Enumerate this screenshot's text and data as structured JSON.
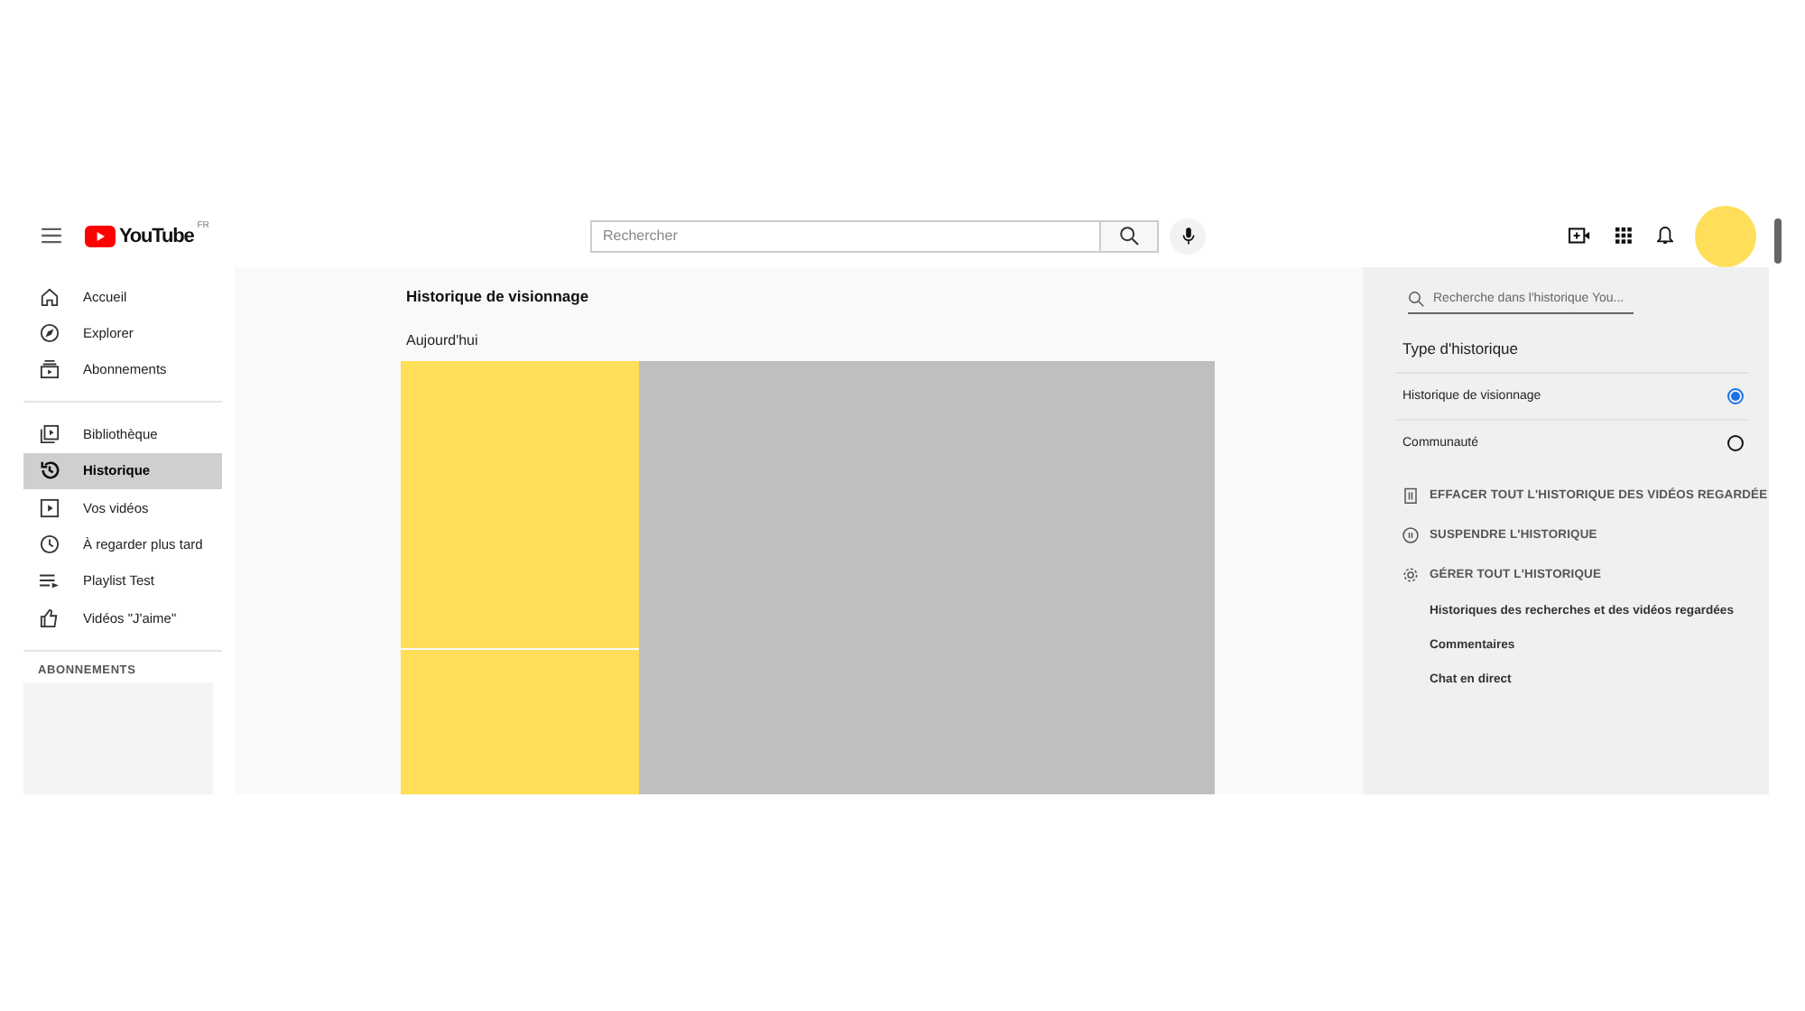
{
  "header": {
    "logo_text": "YouTube",
    "region": "FR",
    "search_placeholder": "Rechercher"
  },
  "sidebar": {
    "sections": [
      [
        {
          "label": "Accueil",
          "kind": "home",
          "selected": false
        },
        {
          "label": "Explorer",
          "kind": "compass",
          "selected": false
        },
        {
          "label": "Abonnements",
          "kind": "subs",
          "selected": false
        }
      ],
      [
        {
          "label": "Bibliothèque",
          "kind": "library",
          "selected": false
        },
        {
          "label": "Historique",
          "kind": "history",
          "selected": true
        },
        {
          "label": "Vos vidéos",
          "kind": "play",
          "selected": false
        },
        {
          "label": "À regarder plus tard",
          "kind": "clock",
          "selected": false
        },
        {
          "label": "Playlist Test",
          "kind": "playlist",
          "selected": false
        },
        {
          "label": "Vidéos \"J'aime\"",
          "kind": "like",
          "selected": false
        }
      ]
    ],
    "subscriptions_heading": "ABONNEMENTS"
  },
  "main": {
    "title": "Historique de visionnage",
    "date_heading": "Aujourd'hui"
  },
  "panel": {
    "search_placeholder": "Recherche dans l'historique You...",
    "type_heading": "Type d'historique",
    "options": [
      {
        "label": "Historique de visionnage",
        "selected": true
      },
      {
        "label": "Communauté",
        "selected": false
      }
    ],
    "actions": [
      {
        "label": "EFFACER TOUT L'HISTORIQUE DES VIDÉOS REGARDÉE",
        "kind": "trash"
      },
      {
        "label": "SUSPENDRE L'HISTORIQUE",
        "kind": "pause"
      },
      {
        "label": "GÉRER TOUT L'HISTORIQUE",
        "kind": "gear"
      }
    ],
    "links": [
      "Historiques des recherches et des vidéos regardées",
      "Commentaires",
      "Chat en direct"
    ]
  }
}
